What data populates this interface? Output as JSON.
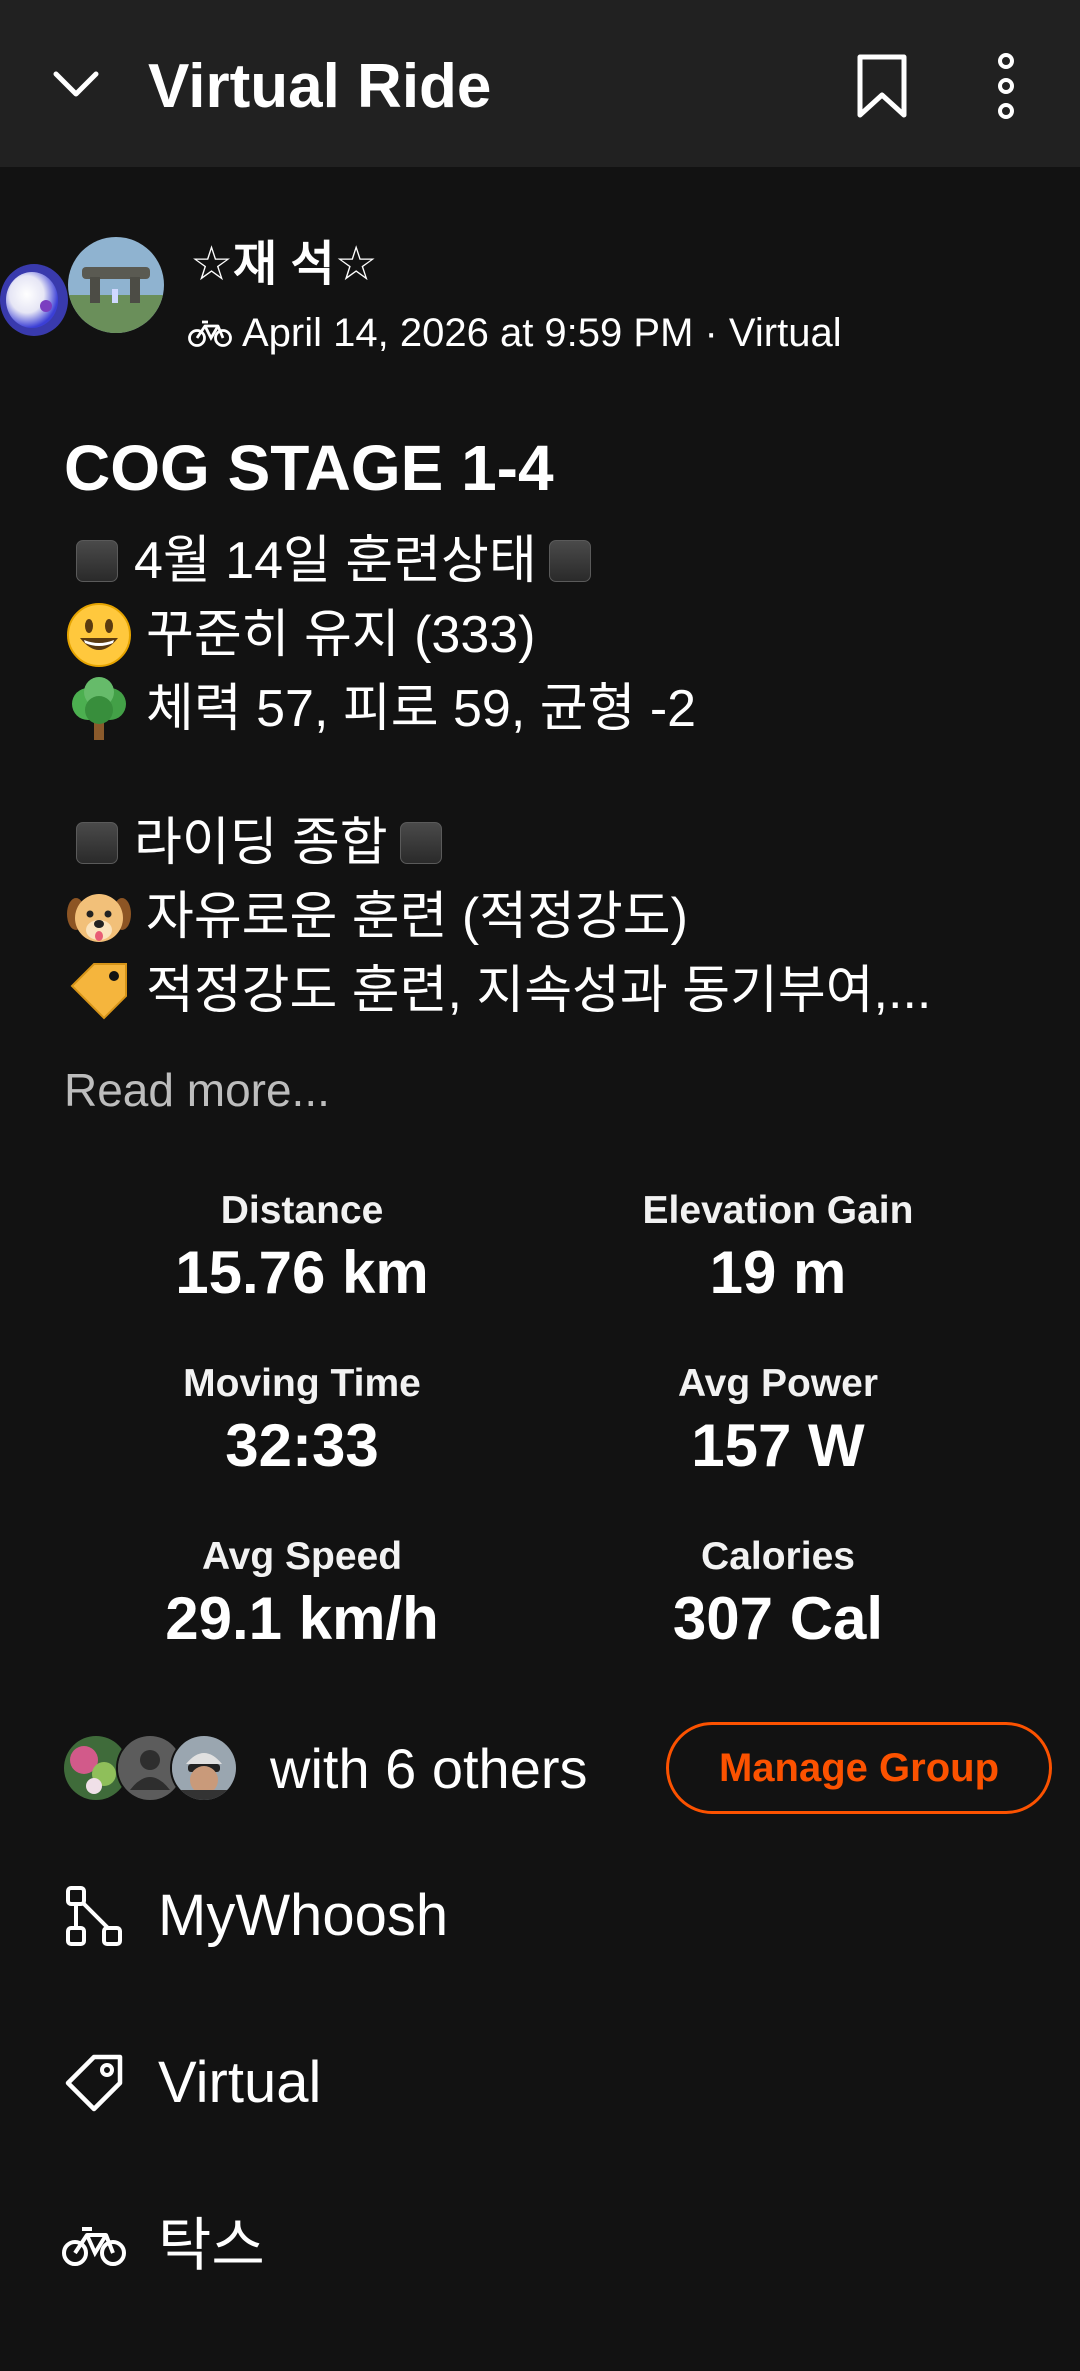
{
  "app_bar": {
    "title": "Virtual Ride",
    "back_icon": "chevron-down-icon",
    "bookmark_icon": "bookmark-icon",
    "more_icon": "more-vertical-icon"
  },
  "athlete": {
    "name": "☆재 석☆",
    "meta": "April 14, 2026 at 9:59 PM · Virtual"
  },
  "activity": {
    "title": "COG STAGE 1-4",
    "description_lines": [
      "4월 14일 훈련상태",
      "꾸준히 유지 (333)",
      "체력 57, 피로 59, 균형 -2",
      "라이딩 종합",
      "자유로운 훈련 (적정강도)",
      "적정강도 훈련, 지속성과 동기부여,..."
    ],
    "read_more": "Read more..."
  },
  "stats": [
    {
      "label": "Distance",
      "value": "15.76 km"
    },
    {
      "label": "Elevation Gain",
      "value": "19 m"
    },
    {
      "label": "Moving Time",
      "value": "32:33"
    },
    {
      "label": "Avg Power",
      "value": "157 W"
    },
    {
      "label": "Avg Speed",
      "value": "29.1 km/h"
    },
    {
      "label": "Calories",
      "value": "307 Cal"
    }
  ],
  "group": {
    "with_others": "with 6 others",
    "manage_label": "Manage Group"
  },
  "details": [
    {
      "icon": "route-icon",
      "label": "MyWhoosh"
    },
    {
      "icon": "tag-icon",
      "label": "Virtual"
    },
    {
      "icon": "bike-icon",
      "label": "탁스"
    }
  ],
  "colors": {
    "accent": "#fc5200",
    "background": "#121212",
    "app_bar": "#212121"
  }
}
